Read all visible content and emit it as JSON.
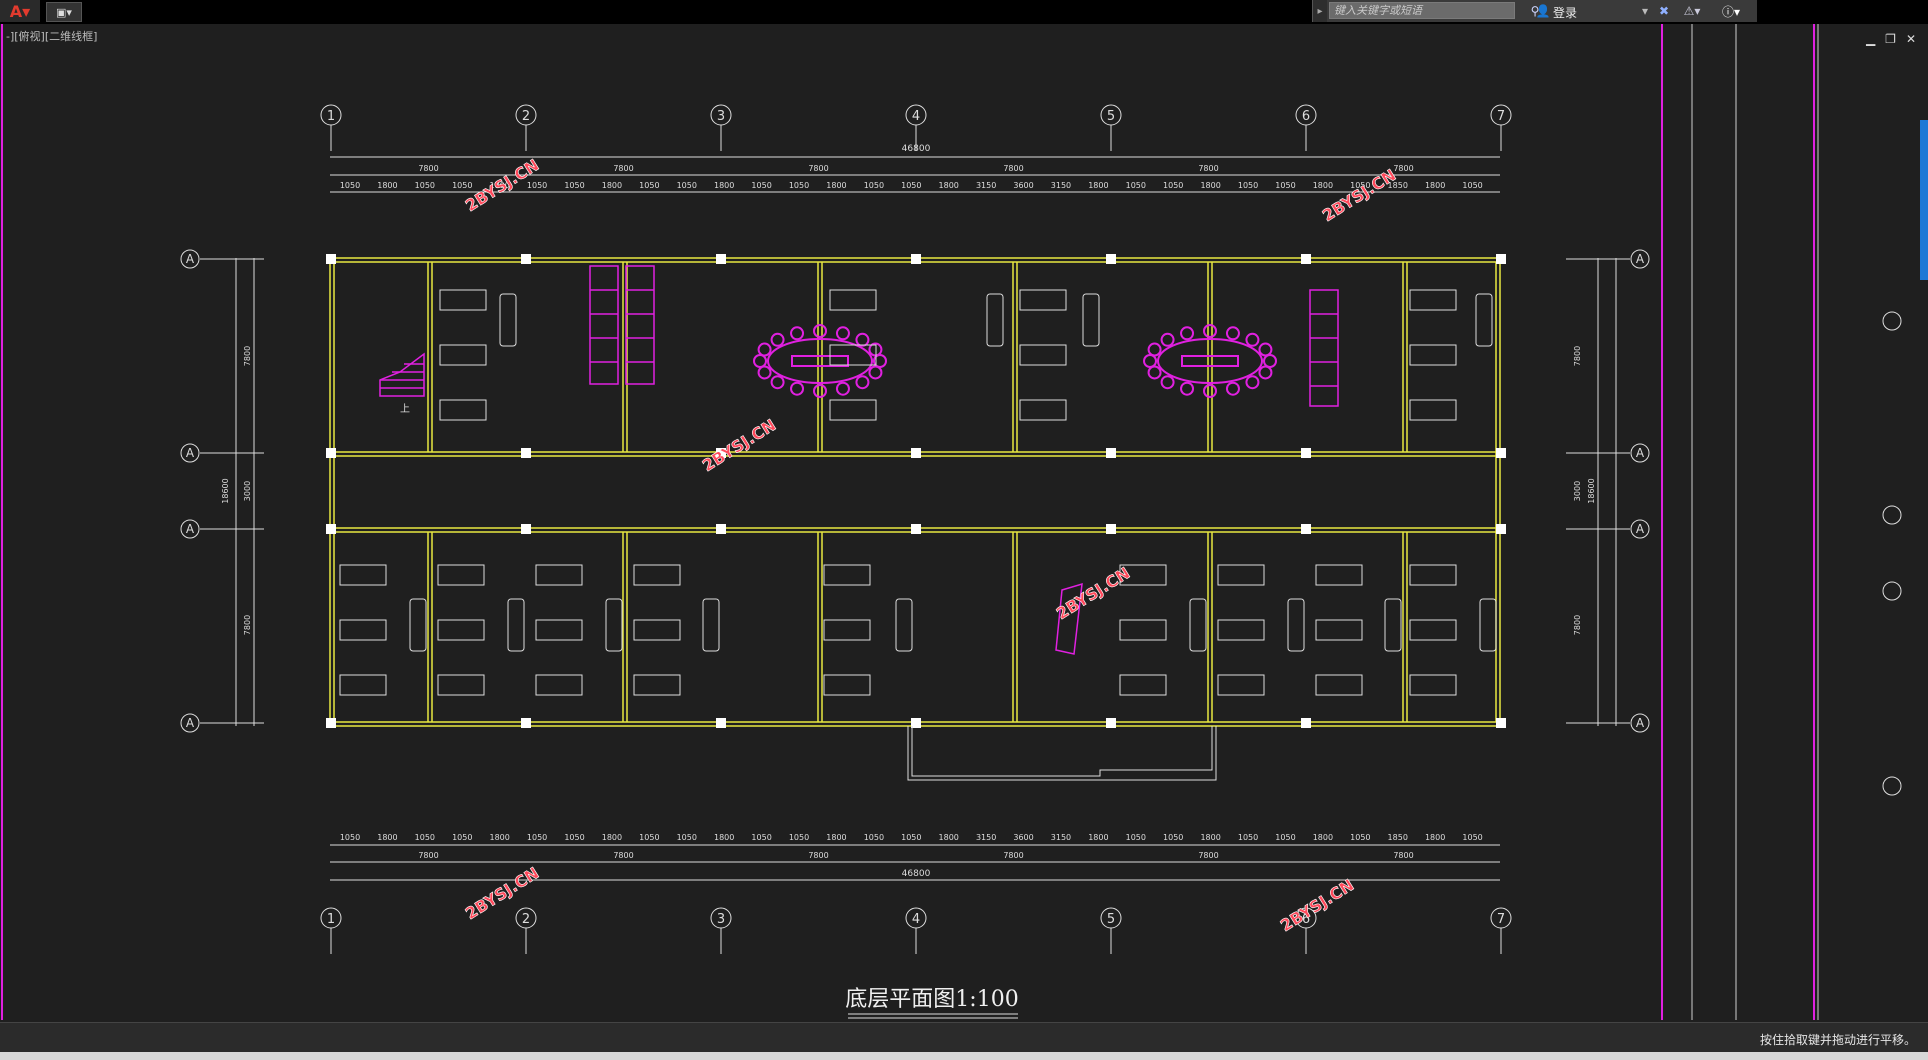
{
  "toolbar": {
    "app_icon": "autocad-logo-icon",
    "quick_access_icon": "save-icon",
    "search_placeholder": "键入关键字或短语",
    "login_label": "登录",
    "exchange_icon": "exchange-x-icon",
    "community_icon": "a360-icon",
    "help_icon": "help-icon"
  },
  "viewport": {
    "label": "-][俯视][二维线框]"
  },
  "drawing": {
    "title": "底层平面图1:100",
    "grid_columns": [
      "1",
      "2",
      "3",
      "4",
      "5",
      "6",
      "7"
    ],
    "grid_rows": [
      "A",
      "A",
      "A",
      "A"
    ],
    "top_total_dim": "46800",
    "bottom_total_dim": "46800",
    "top_bay_dims": [
      "7800",
      "7800",
      "7800",
      "7800",
      "7800",
      "7800"
    ],
    "bottom_bay_dims": [
      "7800",
      "7800",
      "7800",
      "7800",
      "7800",
      "7800"
    ],
    "detail_dims": [
      "1050",
      "1800",
      "1050",
      "1050",
      "1800",
      "1050",
      "1050",
      "1800",
      "1050",
      "1050",
      "1800",
      "1050",
      "1050",
      "1800",
      "1050",
      "1050",
      "1800",
      "3150",
      "3600",
      "3150",
      "1800",
      "1050",
      "1050",
      "1800",
      "1050",
      "1050",
      "1800",
      "1050",
      "1850",
      "1800",
      "1050"
    ],
    "left_dims": [
      "7800",
      "3000",
      "7800"
    ],
    "left_total": "18600",
    "right_dims": [
      "7800",
      "3000",
      "7800"
    ],
    "right_total": "18600",
    "watermark": "2BYSJ.CN",
    "stair_label": "上"
  },
  "status": {
    "message": "按住拾取键并拖动进行平移。"
  }
}
